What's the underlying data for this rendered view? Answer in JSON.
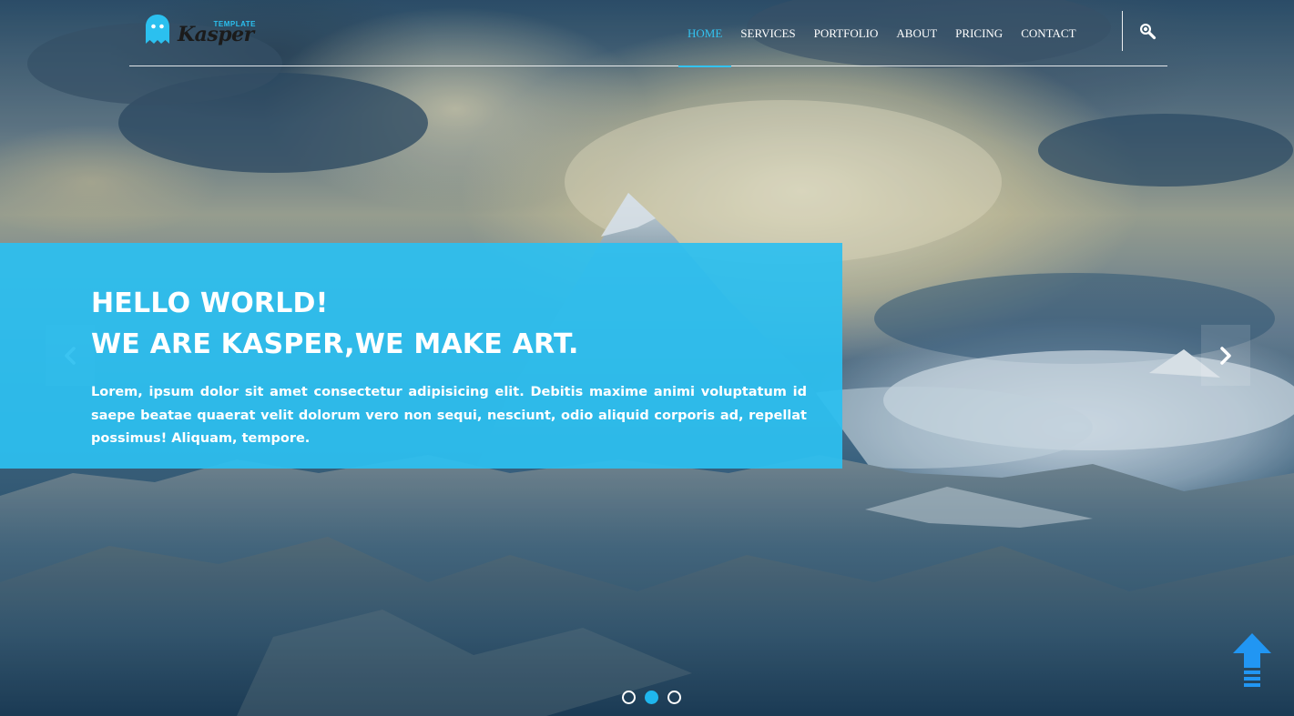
{
  "brand": {
    "name": "Kasper",
    "tag": "TEMPLATE",
    "accent_color": "#2bc0ef",
    "ghost_color": "#2bc0ef"
  },
  "nav": {
    "items": [
      {
        "label": "HOME",
        "active": true
      },
      {
        "label": "SERVICES",
        "active": false
      },
      {
        "label": "PORTFOLIO",
        "active": false
      },
      {
        "label": "ABOUT",
        "active": false
      },
      {
        "label": "PRICING",
        "active": false
      },
      {
        "label": "CONTACT",
        "active": false
      }
    ],
    "search_icon": "search-icon"
  },
  "slider": {
    "title_line1": "HELLO WORLD!",
    "title_line2": "WE ARE KASPER,WE MAKE ART.",
    "text": "Lorem, ipsum dolor sit amet consectetur adipisicing elit. Debitis maxime animi voluptatum id saepe beatae quaerat velit dolorum vero non sequi, nesciunt, odio aliquid corporis ad, repellat possimus! Aliquam, tempore.",
    "box_color": "#2cc0f0",
    "prev_icon": "chevron-left-icon",
    "next_icon": "chevron-right-icon",
    "dots": [
      {
        "active": false
      },
      {
        "active": true
      },
      {
        "active": false
      }
    ]
  },
  "scroll_top": {
    "icon": "arrow-up-icon",
    "color": "#2196f3"
  }
}
